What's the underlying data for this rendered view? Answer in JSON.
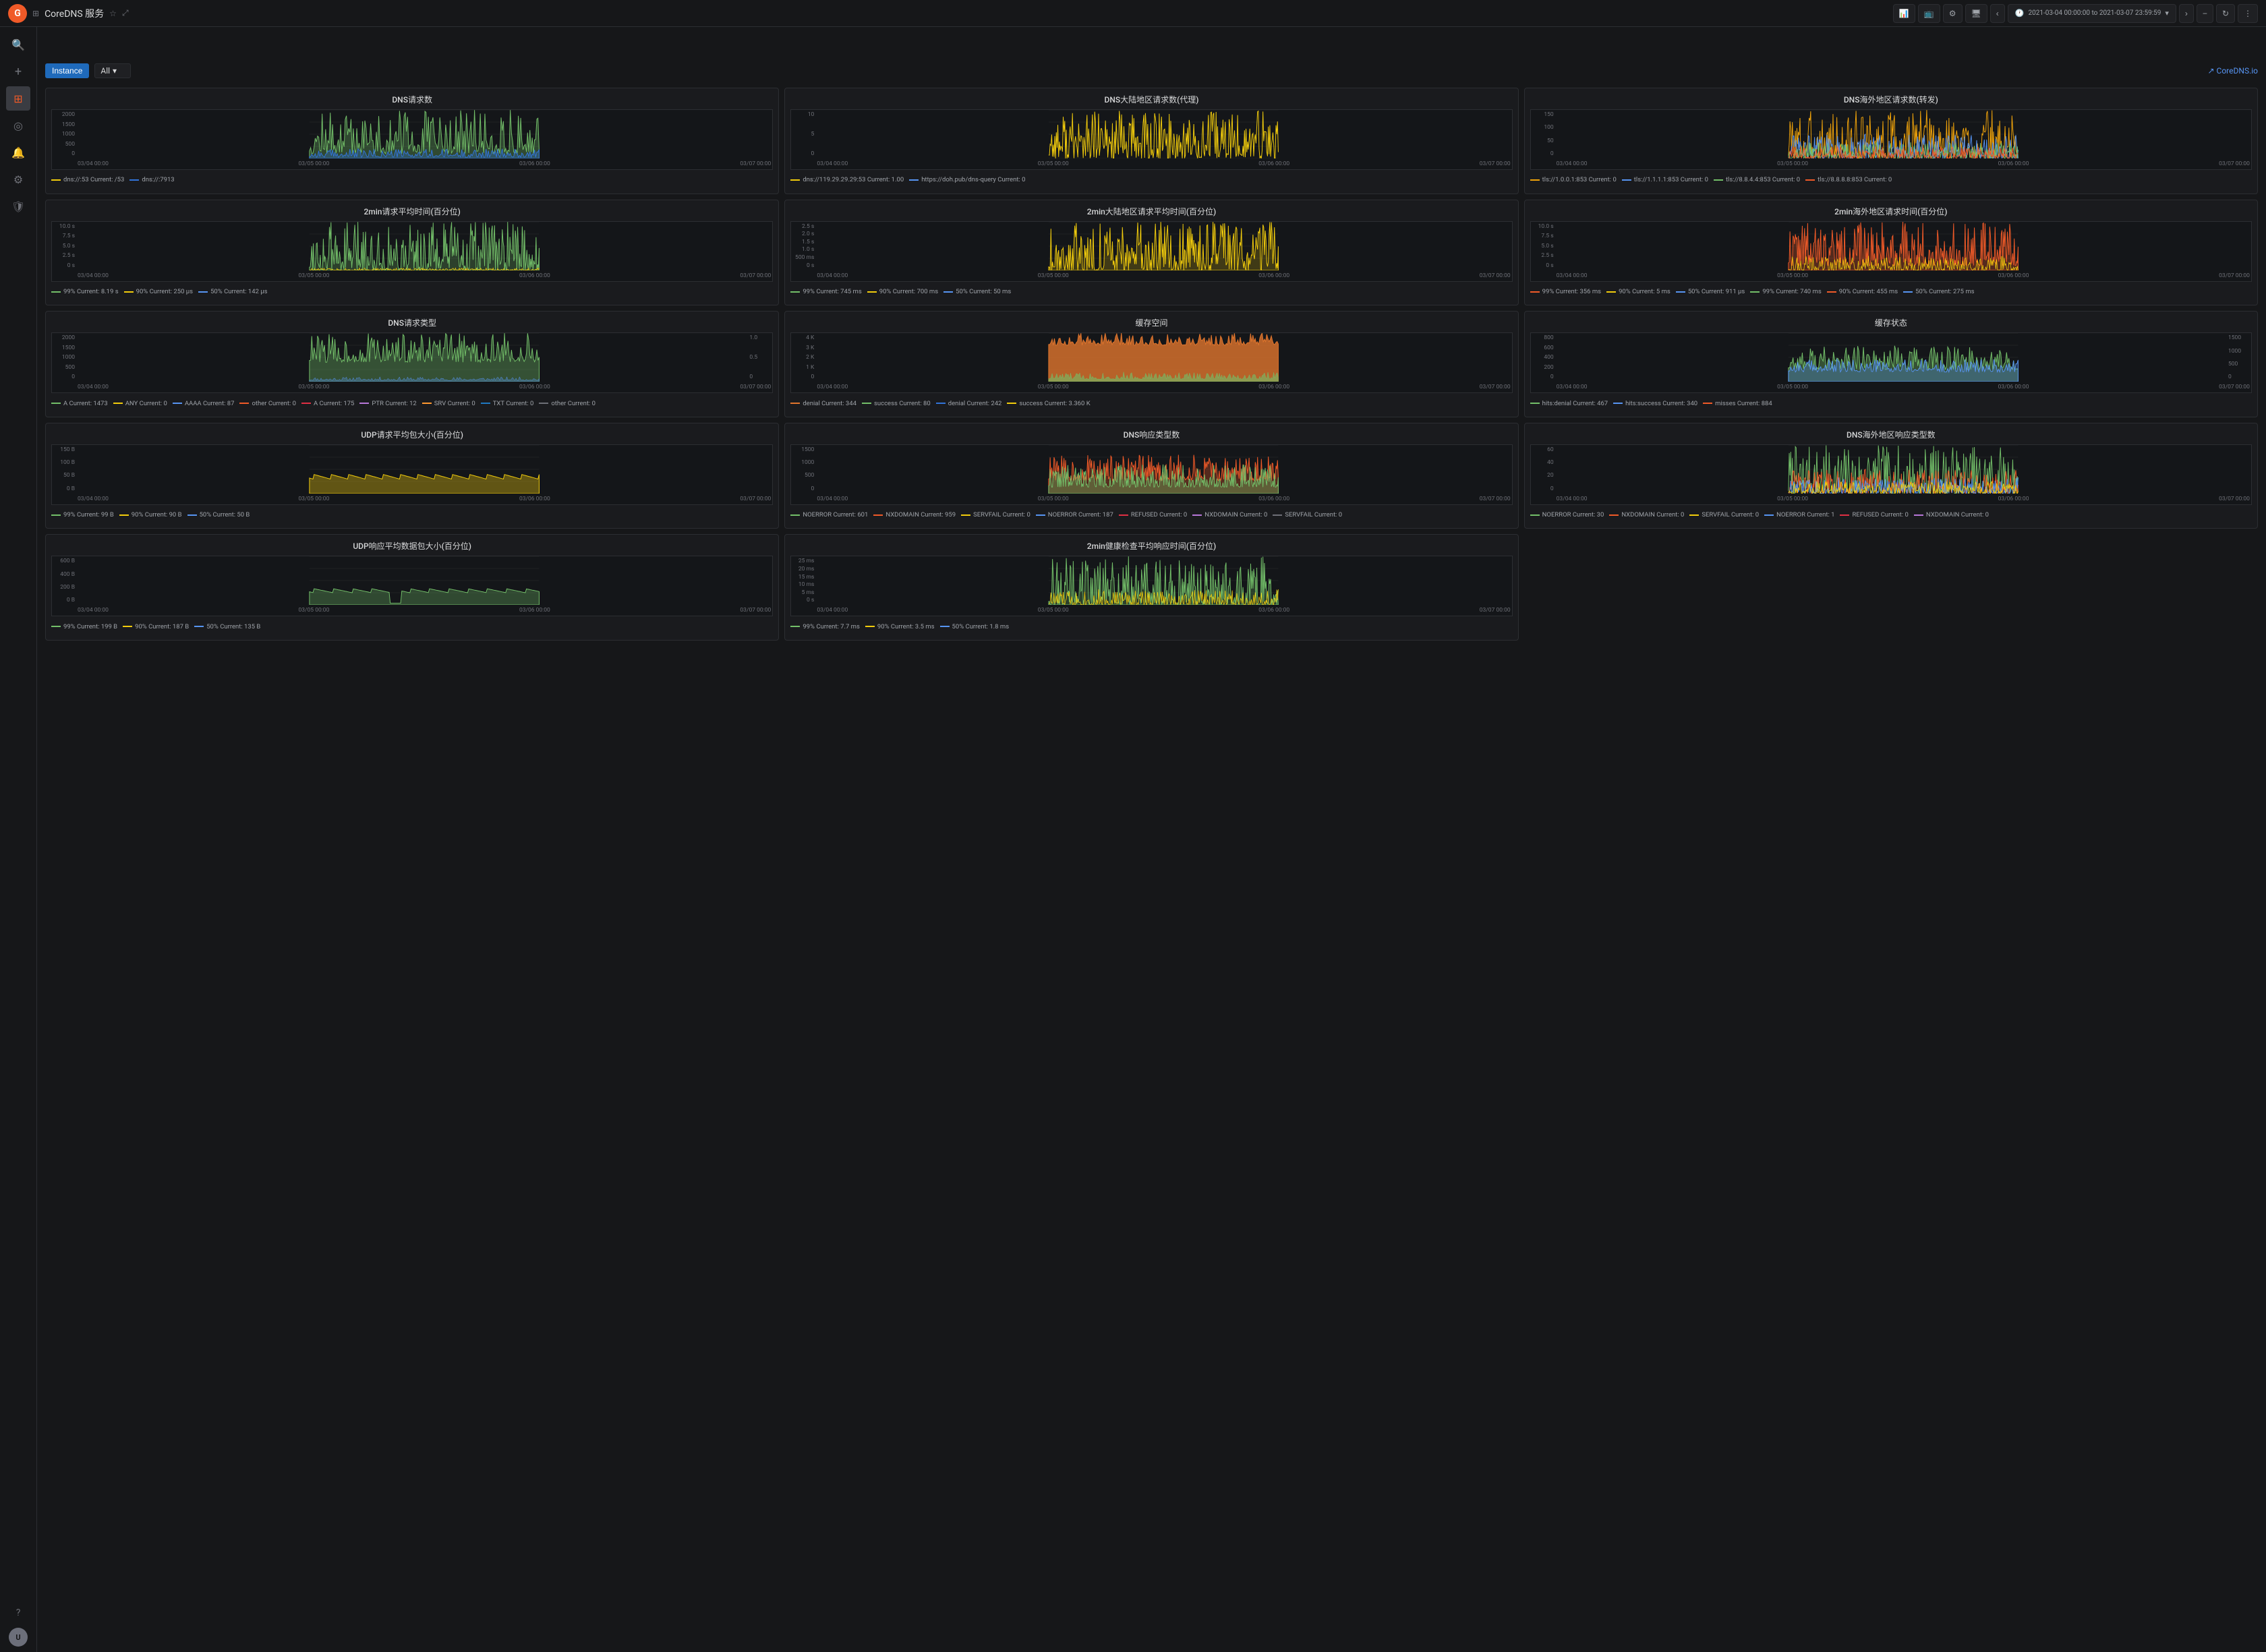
{
  "app": {
    "logo": "G",
    "title": "CoreDNS 服务",
    "star_icon": "☆",
    "share_icon": "⤢"
  },
  "topbar": {
    "chart_icon": "📊",
    "tv_icon": "📺",
    "settings_icon": "⚙",
    "monitor_icon": "🖥",
    "prev_icon": "‹",
    "next_icon": "›",
    "time_range": "2021-03-04 00:00:00 to 2021-03-07 23:59:59",
    "zoom_out": "−",
    "refresh": "↻",
    "more": "⋮"
  },
  "filter": {
    "instance_label": "Instance",
    "all_label": "All",
    "coreDNS_link": "↗ CoreDNS.io"
  },
  "panels": [
    {
      "id": "dns-requests",
      "title": "DNS请求数",
      "yaxis": [
        "2000",
        "1500",
        "1000",
        "500",
        "0"
      ],
      "xaxis": [
        "03/04 00:00",
        "03/05 00:00",
        "03/06 00:00",
        "03/07 00:00"
      ],
      "legend": [
        {
          "color": "#f2cc0c",
          "label": "dns://:53  Current: /53"
        },
        {
          "color": "#3274d9",
          "label": "dns://:7913"
        }
      ],
      "chart_type": "area_green"
    },
    {
      "id": "dns-mainland-requests",
      "title": "DNS大陆地区请求数(代理)",
      "yaxis": [
        "10",
        "5",
        "0"
      ],
      "xaxis": [
        "03/04 00:00",
        "03/05 00:00",
        "03/06 00:00",
        "03/07 00:00"
      ],
      "legend": [
        {
          "color": "#f2cc0c",
          "label": "dns://119.29.29.29:53  Current: 1.00"
        },
        {
          "color": "#5794f2",
          "label": "https://doh.pub/dns-query  Current: 0"
        }
      ],
      "chart_type": "spiky_yellow"
    },
    {
      "id": "dns-overseas-requests",
      "title": "DNS海外地区请求数(转发)",
      "yaxis": [
        "150",
        "100",
        "50",
        "0"
      ],
      "xaxis": [
        "03/04 00:00",
        "03/05 00:00",
        "03/06 00:00",
        "03/07 00:00"
      ],
      "legend": [
        {
          "color": "#f0a30a",
          "label": "tls://1.0.0.1:853  Current: 0"
        },
        {
          "color": "#5794f2",
          "label": "tls://1.1.1.1:853  Current: 0"
        },
        {
          "color": "#73bf69",
          "label": "tls://8.8.4.4:853  Current: 0"
        },
        {
          "color": "#f05a28",
          "label": "tls://8.8.8.8:853  Current: 0"
        }
      ],
      "chart_type": "multi_color"
    },
    {
      "id": "latency-2min",
      "title": "2min请求平均时间(百分位)",
      "yaxis": [
        "10.0 s",
        "7.5 s",
        "5.0 s",
        "2.5 s",
        "0 s"
      ],
      "xaxis": [
        "03/04 00:00",
        "03/05 00:00",
        "03/06 00:00",
        "03/07 00:00"
      ],
      "legend": [
        {
          "color": "#73bf69",
          "label": "99%  Current: 8.19 s"
        },
        {
          "color": "#f2cc0c",
          "label": "90%  Current: 250 μs"
        },
        {
          "color": "#5794f2",
          "label": "50%  Current: 142 μs"
        }
      ],
      "chart_type": "spiky_green"
    },
    {
      "id": "mainland-latency-2min",
      "title": "2min大陆地区请求平均时间(百分位)",
      "yaxis": [
        "2.5 s",
        "2.0 s",
        "1.5 s",
        "1.0 s",
        "500 ms",
        "0 s"
      ],
      "xaxis": [
        "03/04 00:00",
        "03/05 00:00",
        "03/06 00:00",
        "03/07 00:00"
      ],
      "legend": [
        {
          "color": "#73bf69",
          "label": "99%  Current: 745 ms"
        },
        {
          "color": "#f2cc0c",
          "label": "90%  Current: 700 ms"
        },
        {
          "color": "#5794f2",
          "label": "50%  Current: 50 ms"
        }
      ],
      "chart_type": "spiky_yellow2"
    },
    {
      "id": "overseas-latency-2min",
      "title": "2min海外地区请求时间(百分位)",
      "yaxis": [
        "10.0 s",
        "7.5 s",
        "5.0 s",
        "2.5 s",
        "0 s"
      ],
      "xaxis": [
        "03/04 00:00",
        "03/05 00:00",
        "03/06 00:00",
        "03/07 00:00"
      ],
      "legend": [
        {
          "color": "#f05a28",
          "label": "99%  Current: 356 ms"
        },
        {
          "color": "#f2cc0c",
          "label": "90%  Current: 5 ms"
        },
        {
          "color": "#5794f2",
          "label": "50%  Current: 911 μs"
        },
        {
          "color": "#73bf69",
          "label": "99%  Current: 740 ms"
        },
        {
          "color": "#f05a28",
          "label": "90%  Current: 455 ms"
        },
        {
          "color": "#5794f2",
          "label": "50%  Current: 275 ms"
        }
      ],
      "chart_type": "red_spiky"
    },
    {
      "id": "dns-request-type",
      "title": "DNS请求类型",
      "yaxis": [
        "2000",
        "1500",
        "1000",
        "500",
        "0"
      ],
      "xaxis": [
        "03/04 00:00",
        "03/05 00:00",
        "03/06 00:00",
        "03/07 00:00"
      ],
      "legend": [
        {
          "color": "#73bf69",
          "label": "A  Current: 1473"
        },
        {
          "color": "#f2cc0c",
          "label": "ANY  Current: 0"
        },
        {
          "color": "#5794f2",
          "label": "AAAA  Current: 87"
        },
        {
          "color": "#f05a28",
          "label": "other  Current: 0"
        },
        {
          "color": "#e02f44",
          "label": "A  Current: 175"
        },
        {
          "color": "#b877d9",
          "label": "PTR  Current: 12"
        },
        {
          "color": "#ff9830",
          "label": "SRV  Current: 0"
        },
        {
          "color": "#1f78c1",
          "label": "TXT  Current: 0"
        },
        {
          "color": "#6e7077",
          "label": "other  Current: 0"
        }
      ],
      "chart_type": "stacked_green",
      "yaxis2": [
        "1.0",
        "0.5",
        "0"
      ]
    },
    {
      "id": "cache-space",
      "title": "缓存空间",
      "yaxis": [
        "4 K",
        "3 K",
        "2 K",
        "1 K",
        "0"
      ],
      "xaxis": [
        "03/04 00:00",
        "03/05 00:00",
        "03/06 00:00",
        "03/07 00:00"
      ],
      "legend": [
        {
          "color": "#e0752d",
          "label": "denial  Current: 344"
        },
        {
          "color": "#73bf69",
          "label": "success  Current: 80"
        },
        {
          "color": "#3274d9",
          "label": "denial  Current: 242"
        },
        {
          "color": "#f2cc0c",
          "label": "success  Current: 3.360 K"
        }
      ],
      "chart_type": "stacked_orange"
    },
    {
      "id": "cache-status",
      "title": "缓存状态",
      "yaxis": [
        "800",
        "600",
        "400",
        "200",
        "0"
      ],
      "yaxis2": [
        "1500",
        "1000",
        "500",
        "0"
      ],
      "xaxis": [
        "03/04 00:00",
        "03/05 00:00",
        "03/06 00:00",
        "03/07 00:00"
      ],
      "legend": [
        {
          "color": "#73bf69",
          "label": "hits:denial  Current: 467"
        },
        {
          "color": "#5794f2",
          "label": "hits:success  Current: 340"
        },
        {
          "color": "#f05a28",
          "label": "misses  Current: 884"
        }
      ],
      "chart_type": "cache_status"
    },
    {
      "id": "udp-request-size",
      "title": "UDP请求平均包大小(百分位)",
      "yaxis": [
        "150 B",
        "100 B",
        "50 B",
        "0 B"
      ],
      "xaxis": [
        "03/04 00:00",
        "03/05 00:00",
        "03/06 00:00",
        "03/07 00:00"
      ],
      "legend": [
        {
          "color": "#73bf69",
          "label": "99%  Current: 99 B"
        },
        {
          "color": "#f2cc0c",
          "label": "90%  Current: 90 B"
        },
        {
          "color": "#5794f2",
          "label": "50%  Current: 50 B"
        }
      ],
      "chart_type": "flat_yellow"
    },
    {
      "id": "dns-response-type",
      "title": "DNS响应类型数",
      "yaxis": [
        "1500",
        "1000",
        "500",
        "0"
      ],
      "xaxis": [
        "03/04 00:00",
        "03/05 00:00",
        "03/06 00:00",
        "03/07 00:00"
      ],
      "legend": [
        {
          "color": "#73bf69",
          "label": "NOERROR  Current: 601"
        },
        {
          "color": "#f05a28",
          "label": "NXDOMAIN  Current: 959"
        },
        {
          "color": "#f2cc0c",
          "label": "SERVFAIL  Current: 0"
        },
        {
          "color": "#5794f2",
          "label": "NOERROR  Current: 187"
        },
        {
          "color": "#e02f44",
          "label": "REFUSED  Current: 0"
        },
        {
          "color": "#b877d9",
          "label": "NXDOMAIN  Current: 0"
        },
        {
          "color": "#6e7077",
          "label": "SERVFAIL  Current: 0"
        }
      ],
      "chart_type": "response_type"
    },
    {
      "id": "dns-overseas-response-type",
      "title": "DNS海外地区响应类型数",
      "yaxis": [
        "60",
        "40",
        "20",
        "0"
      ],
      "xaxis": [
        "03/04 00:00",
        "03/05 00:00",
        "03/06 00:00",
        "03/07 00:00"
      ],
      "legend": [
        {
          "color": "#73bf69",
          "label": "NOERROR  Current: 30"
        },
        {
          "color": "#f05a28",
          "label": "NXDOMAIN  Current: 0"
        },
        {
          "color": "#f2cc0c",
          "label": "SERVFAIL  Current: 0"
        },
        {
          "color": "#5794f2",
          "label": "NOERROR  Current: 1"
        },
        {
          "color": "#e02f44",
          "label": "REFUSED  Current: 0"
        },
        {
          "color": "#b877d9",
          "label": "NXDOMAIN  Current: 0"
        }
      ],
      "chart_type": "overseas_response"
    },
    {
      "id": "udp-response-size",
      "title": "UDP响应平均数据包大小(百分位)",
      "yaxis": [
        "600 B",
        "400 B",
        "200 B",
        "0 B"
      ],
      "xaxis": [
        "03/04 00:00",
        "03/05 00:00",
        "03/06 00:00",
        "03/07 00:00"
      ],
      "legend": [
        {
          "color": "#73bf69",
          "label": "99%  Current: 199 B"
        },
        {
          "color": "#f2cc0c",
          "label": "90%  Current: 187 B"
        },
        {
          "color": "#5794f2",
          "label": "50%  Current: 135 B"
        }
      ],
      "chart_type": "flat_green"
    },
    {
      "id": "health-check-latency",
      "title": "2min健康检查平均响应时间(百分位)",
      "yaxis": [
        "25 ms",
        "20 ms",
        "15 ms",
        "10 ms",
        "5 ms",
        "0 s"
      ],
      "xaxis": [
        "03/04 00:00",
        "03/05 00:00",
        "03/06 00:00",
        "03/07 00:00"
      ],
      "legend": [
        {
          "color": "#73bf69",
          "label": "99%  Current: 7.7 ms"
        },
        {
          "color": "#f2cc0c",
          "label": "90%  Current: 3.5 ms"
        },
        {
          "color": "#5794f2",
          "label": "50%  Current: 1.8 ms"
        }
      ],
      "chart_type": "health_check"
    }
  ],
  "sidebar": {
    "search_icon": "🔍",
    "plus_icon": "+",
    "grid_icon": "⊞",
    "compass_icon": "◎",
    "bell_icon": "🔔",
    "settings_icon": "⚙",
    "shield_icon": "🛡",
    "help_icon": "?",
    "user_initial": "U"
  }
}
